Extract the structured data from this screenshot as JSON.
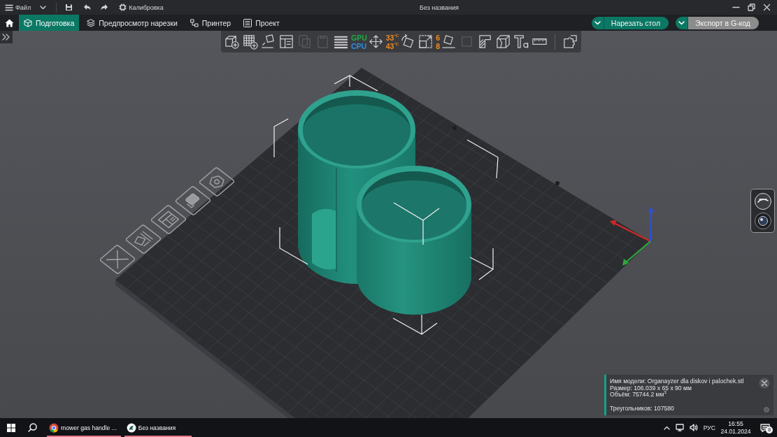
{
  "menu_bar": {
    "file_menu": "Файл",
    "calibration": "Калибровка"
  },
  "window": {
    "title": "Без названия"
  },
  "tabs": [
    {
      "label": "Подготовка",
      "kind": "prepare",
      "selected": true
    },
    {
      "label": "Предпросмотр нарезки",
      "kind": "preview",
      "selected": false
    },
    {
      "label": "Принтер",
      "kind": "device",
      "selected": false
    },
    {
      "label": "Проект",
      "kind": "project",
      "selected": false
    }
  ],
  "actions": [
    {
      "label": "Нарезать стол",
      "kind": "primary"
    },
    {
      "label": "Экспорт в G-код",
      "kind": "secondary"
    }
  ],
  "toolbar": [
    {
      "kind": "add",
      "disabled": false
    },
    {
      "kind": "add_plate",
      "disabled": false
    },
    {
      "kind": "auto_orient",
      "disabled": false
    },
    {
      "kind": "arrange",
      "disabled": false
    },
    {
      "kind": "copy",
      "disabled": true
    },
    {
      "kind": "paste",
      "disabled": true
    },
    {
      "kind": "layers",
      "disabled": false
    },
    {
      "kind": "move",
      "disabled": false,
      "readings": [
        {
          "text": "GPU",
          "color": "#1fae46"
        },
        {
          "text": "CPU",
          "color": "#2b8fe6"
        }
      ]
    },
    {
      "kind": "rotate",
      "disabled": false,
      "readings": [
        {
          "text": "33$^{°C}$",
          "color": "#f08c1e"
        },
        {
          "text": "43$^{°C}$",
          "color": "#f08c1e"
        }
      ]
    },
    {
      "kind": "scale",
      "disabled": false
    },
    {
      "kind": "lay_on_face",
      "disabled": false,
      "readings": [
        {
          "text": "6",
          "color": "#f08c1e"
        },
        {
          "text": "8",
          "color": "#f08c1e"
        }
      ]
    },
    {
      "kind": "mirror",
      "disabled": true
    },
    {
      "kind": "support",
      "disabled": false
    },
    {
      "kind": "cut",
      "disabled": false
    },
    {
      "kind": "text",
      "disabled": false
    },
    {
      "kind": "measure",
      "disabled": false
    },
    {
      "kind": "separator"
    },
    {
      "kind": "assembly",
      "disabled": false
    }
  ],
  "info_panel": {
    "lines": [
      "Имя модели: Organayzer dla diskov i palochek.stl",
      "Размер: 106.039 x 65 x 90 мм",
      "Объём: 75744.2 мм$^{3}$"
    ],
    "triangles": "Треугольников: 107580"
  },
  "taskbar": {
    "apps": [
      {
        "label": "mower gas handle ...",
        "kind": "browser",
        "running": true
      },
      {
        "label": "Без названия",
        "kind": "slicer",
        "running": true
      }
    ],
    "language": "РУС",
    "time": "16:55",
    "date": "24.01.2024",
    "notifications": "8"
  }
}
